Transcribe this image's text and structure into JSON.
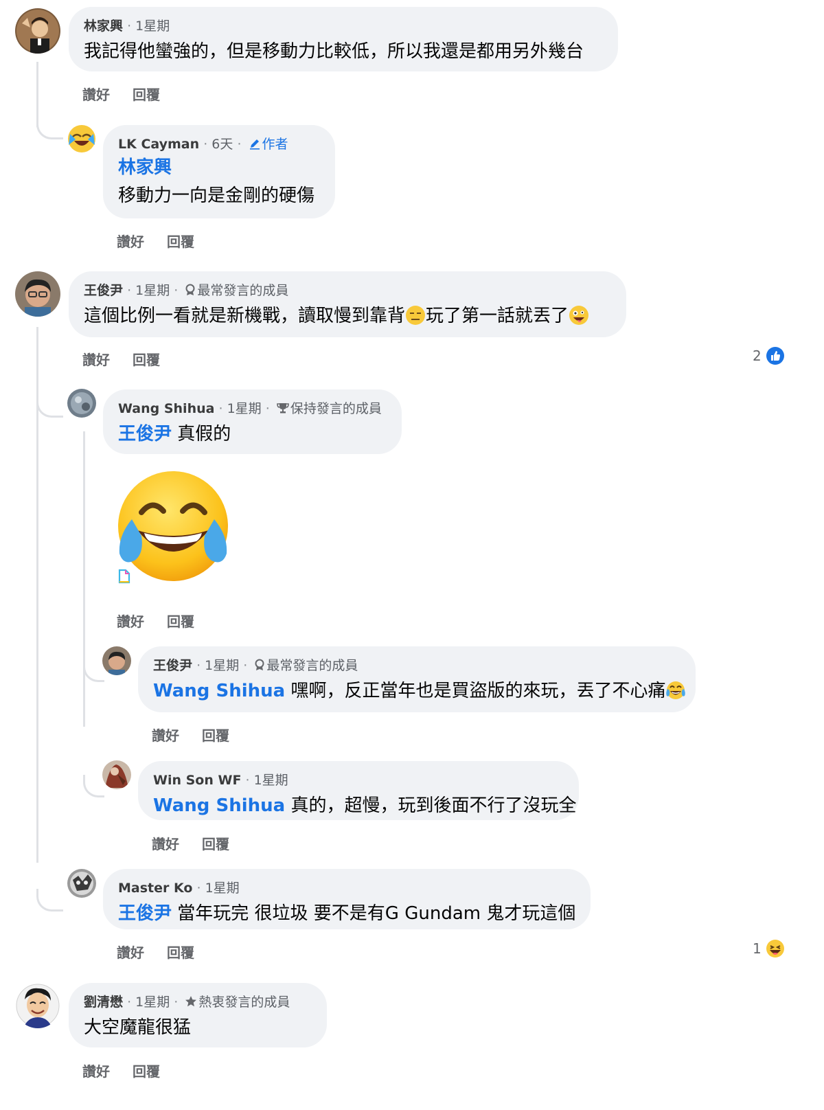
{
  "actions": {
    "like": "讚好",
    "reply": "回覆"
  },
  "comments": [
    {
      "author": "林家興",
      "time": "1星期",
      "text": "我記得他蠻強的，但是移動力比較低，所以我還是都用另外幾台"
    },
    {
      "author": "LK Cayman",
      "time": "6天",
      "badge": "作者",
      "mention": "林家興",
      "text": "移動力一向是金剛的硬傷"
    },
    {
      "author": "王俊尹",
      "time": "1星期",
      "badge": "最常發言的成員",
      "text_a": "這個比例一看就是新機戰，讀取慢到靠背",
      "text_b": "玩了第一話就丟了",
      "reaction_count": "2",
      "reaction_icon": "like-icon"
    },
    {
      "author": "Wang Shihua",
      "time": "1星期",
      "badge": "保持發言的成員",
      "mention": "王俊尹",
      "text": "真假的",
      "sticker": "laughing-tears-emoji"
    },
    {
      "author": "王俊尹",
      "time": "1星期",
      "badge": "最常發言的成員",
      "mention": "Wang Shihua",
      "text": "嘿啊，反正當年也是買盜版的來玩，丟了不心痛"
    },
    {
      "author": "Win Son WF",
      "time": "1星期",
      "mention": "Wang Shihua",
      "text": "真的，超慢，玩到後面不行了沒玩全"
    },
    {
      "author": "Master Ko",
      "time": "1星期",
      "mention": "王俊尹",
      "text": "當年玩完 很垃圾 要不是有G Gundam 鬼才玩這個",
      "reaction_count": "1",
      "reaction_icon": "haha-icon"
    },
    {
      "author": "劉清懋",
      "time": "1星期",
      "badge": "熱衷發言的成員",
      "text": "大空魔龍很猛"
    }
  ],
  "colors": {
    "bubble": "#f0f2f5",
    "mention": "#1b74e4",
    "meta": "#65676b",
    "thread_line": "#dfe1e5"
  }
}
